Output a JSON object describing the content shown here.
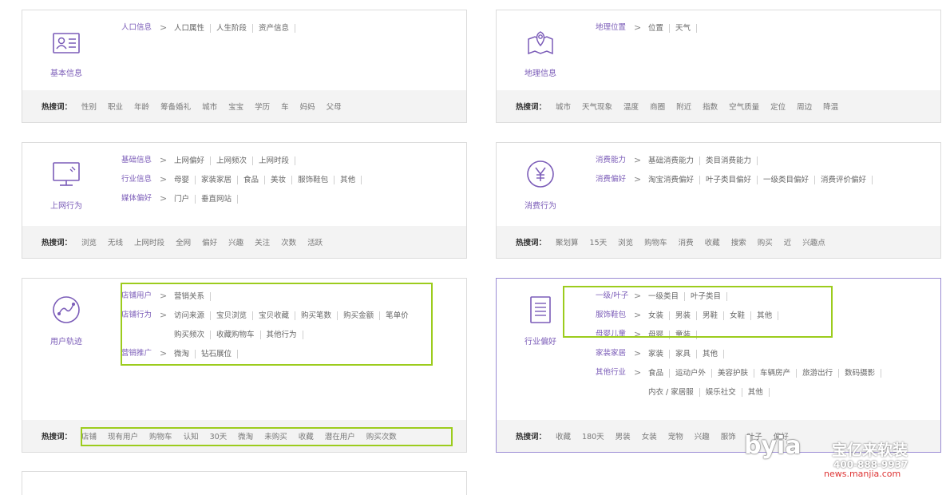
{
  "hot_label": "热搜词：",
  "cards": {
    "basic": {
      "title": "基本信息",
      "rows": [
        {
          "key": "人口信息",
          "values": [
            "人口属性",
            "人生阶段",
            "资产信息"
          ]
        }
      ],
      "hot": [
        "性别",
        "职业",
        "年龄",
        "筹备婚礼",
        "城市",
        "宝宝",
        "学历",
        "车",
        "妈妈",
        "父母"
      ]
    },
    "geo": {
      "title": "地理信息",
      "rows": [
        {
          "key": "地理位置",
          "values": [
            "位置",
            "天气"
          ]
        }
      ],
      "hot": [
        "城市",
        "天气现象",
        "温度",
        "商圈",
        "附近",
        "指数",
        "空气质量",
        "定位",
        "周边",
        "降温"
      ]
    },
    "online": {
      "title": "上网行为",
      "rows": [
        {
          "key": "基础信息",
          "values": [
            "上网偏好",
            "上网频次",
            "上网时段"
          ]
        },
        {
          "key": "行业信息",
          "values": [
            "母婴",
            "家装家居",
            "食品",
            "美妆",
            "服饰鞋包",
            "其他"
          ]
        },
        {
          "key": "媒体偏好",
          "values": [
            "门户",
            "垂直网站"
          ]
        }
      ],
      "hot": [
        "浏览",
        "无线",
        "上网时段",
        "全网",
        "偏好",
        "兴趣",
        "关注",
        "次数",
        "活跃"
      ]
    },
    "consume": {
      "title": "消费行为",
      "rows": [
        {
          "key": "消费能力",
          "values": [
            "基础消费能力",
            "类目消费能力"
          ]
        },
        {
          "key": "消费偏好",
          "values": [
            "淘宝消费偏好",
            "叶子类目偏好",
            "一级类目偏好",
            "消费评价偏好"
          ]
        }
      ],
      "hot": [
        "聚划算",
        "15天",
        "浏览",
        "购物车",
        "消费",
        "收藏",
        "搜索",
        "购买",
        "近",
        "兴趣点"
      ]
    },
    "track": {
      "title": "用户轨迹",
      "rows": [
        {
          "key": "店铺用户",
          "values": [
            "营销关系"
          ]
        },
        {
          "key": "店铺行为",
          "values": [
            "访问来源",
            "宝贝浏览",
            "宝贝收藏",
            "购买笔数",
            "购买金额",
            "笔单价"
          ]
        },
        {
          "key": "",
          "values": [
            "购买频次",
            "收藏购物车",
            "其他行为"
          ]
        },
        {
          "key": "营销推广",
          "values": [
            "微淘",
            "钻石展位"
          ]
        }
      ],
      "hot": [
        "店铺",
        "现有用户",
        "购物车",
        "认知",
        "30天",
        "微淘",
        "未购买",
        "收藏",
        "潜在用户",
        "购买次数"
      ]
    },
    "industry": {
      "title": "行业偏好",
      "rows": [
        {
          "key": "一级/叶子",
          "values": [
            "一级类目",
            "叶子类目"
          ]
        },
        {
          "key": "服饰鞋包",
          "values": [
            "女装",
            "男装",
            "男鞋",
            "女鞋",
            "其他"
          ]
        },
        {
          "key": "母婴儿童",
          "values": [
            "母婴",
            "童装"
          ]
        },
        {
          "key": "家装家居",
          "values": [
            "家装",
            "家具",
            "其他"
          ]
        },
        {
          "key": "其他行业",
          "values": [
            "食品",
            "运动户外",
            "美容护肤",
            "车辆房产",
            "旅游出行",
            "数码摄影"
          ]
        },
        {
          "key": "",
          "values": [
            "内衣 / 家居服",
            "娱乐社交",
            "其他"
          ]
        }
      ],
      "hot": [
        "收藏",
        "180天",
        "男装",
        "女装",
        "宠物",
        "兴趣",
        "服饰",
        "叶子",
        "偏好"
      ]
    }
  },
  "watermark": {
    "brand": "byia",
    "cn": "宝亿来软装",
    "tel": "400-888-9937",
    "url": "news.manjia.com"
  },
  "colors": {
    "accent": "#7b5cb8",
    "highlight_box": "#9ccc1d",
    "hot_bg": "#f3f3f3"
  }
}
